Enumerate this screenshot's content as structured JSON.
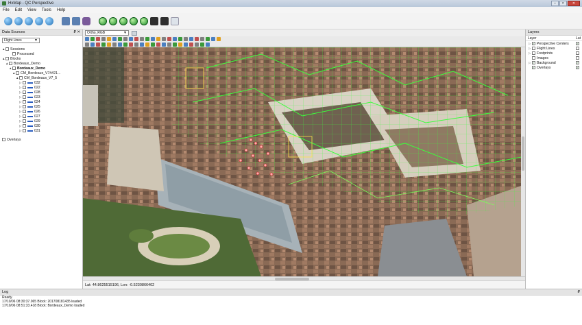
{
  "window": {
    "title": "HxMap - QC Perspective",
    "min": "–",
    "max": "□",
    "close": "✕"
  },
  "menu": [
    "File",
    "Edit",
    "View",
    "Tools",
    "Help"
  ],
  "left_panel": {
    "title": "Data Sources",
    "pin": "₽ ✕",
    "dropdown": "Flight Lines",
    "tree": [
      {
        "label": "Sessions",
        "indent": 0,
        "tw": "▲"
      },
      {
        "label": "Processed",
        "indent": 2,
        "tw": ""
      },
      {
        "label": "Blocks",
        "indent": 0,
        "tw": "▲"
      },
      {
        "label": "Bordeaux_Demo",
        "indent": 1,
        "tw": "▲"
      },
      {
        "label": "Bordeaux_Demo",
        "indent": 2,
        "tw": "▲",
        "bold": true
      },
      {
        "label": "CM_Bordeaux_V7##21...",
        "indent": 3,
        "tw": "▲"
      },
      {
        "label": "CM_Bordeaux_V7_5",
        "indent": 4,
        "tw": "▲"
      },
      {
        "label": "032",
        "indent": 5,
        "tw": "▷",
        "line": true
      },
      {
        "label": "022",
        "indent": 5,
        "tw": "▷",
        "line": true
      },
      {
        "label": "028",
        "indent": 5,
        "tw": "▷",
        "line": true
      },
      {
        "label": "023",
        "indent": 5,
        "tw": "▷",
        "line": true
      },
      {
        "label": "024",
        "indent": 5,
        "tw": "▷",
        "line": true
      },
      {
        "label": "025",
        "indent": 5,
        "tw": "▷",
        "line": true
      },
      {
        "label": "026",
        "indent": 5,
        "tw": "▷",
        "line": true
      },
      {
        "label": "027",
        "indent": 5,
        "tw": "▷",
        "line": true
      },
      {
        "label": "029",
        "indent": 5,
        "tw": "▷",
        "line": true
      },
      {
        "label": "030",
        "indent": 5,
        "tw": "▷",
        "line": true
      },
      {
        "label": "031",
        "indent": 5,
        "tw": "▷",
        "line": true
      }
    ],
    "overlays": "Overlays"
  },
  "map": {
    "source_select": "Ortho_RGB",
    "coords": "Lat: 44.8625515196, Lon: -0.5230866402"
  },
  "right_panel": {
    "title": "Layers",
    "col_layer": "Layer",
    "col_lat": "Lat",
    "layers": [
      {
        "label": "Perspective Centers",
        "tw": "▷",
        "checked": true,
        "checked2": true
      },
      {
        "label": "Flight Lines",
        "tw": "▷",
        "checked": false,
        "checked2": false
      },
      {
        "label": "Footprints",
        "tw": "▷",
        "checked": false,
        "checked2": false
      },
      {
        "label": "Images",
        "tw": "",
        "checked": false,
        "checked2": false
      },
      {
        "label": "Background",
        "tw": "▷",
        "checked": true,
        "checked2": true
      },
      {
        "label": "Overlays",
        "tw": "",
        "checked": true,
        "checked2": true
      }
    ]
  },
  "log": {
    "title": "Log",
    "pin": "₽",
    "lines": [
      "Ready.",
      "17/10/06 08:30:37.065 Block: 201708181435 loaded",
      "17/10/06 08:51:33.418 Block: Bordeaux_Demo loaded"
    ]
  },
  "colors": {
    "overlay_green": "#3cff3c",
    "accent_blue": "#2a5dbf"
  }
}
